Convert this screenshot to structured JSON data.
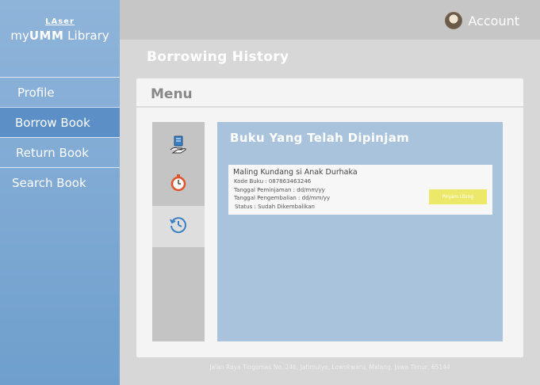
{
  "brand": {
    "logo_top": "LAser",
    "logo_main_prefix": "my",
    "logo_main_bold": "UMM",
    "logo_main_suffix": " Library"
  },
  "sidebar": {
    "items": [
      {
        "label": "Profile"
      },
      {
        "label": "Borrow Book",
        "active": true
      },
      {
        "label": "Return Book"
      },
      {
        "label": "Search Book"
      }
    ]
  },
  "header": {
    "account_label": "Account"
  },
  "page": {
    "title": "Borrowing History"
  },
  "card": {
    "heading": "Menu",
    "icons": [
      "book-hand-icon",
      "stopwatch-icon",
      "history-icon"
    ],
    "content_title": "Buku Yang Telah Dipinjam",
    "book": {
      "title": "Maling Kundang si Anak Durhaka",
      "kode": "Kode Buku : 087863463246",
      "peminjaman": "Tanggal Peminjaman : dd/mm/yy",
      "pengembalian": "Tanggal Pengembalian : dd/mm/yy",
      "status": "Status :  Sudah Dikembalikan",
      "button_label": "Pinjam Ulang"
    }
  },
  "footer": {
    "address": "Jalan Raya Tlogomas No. 246, Jatimulyo, Lowokwaru, Malang, Jawa Timur, 65144"
  },
  "colors": {
    "sidebar": "#7aa7d3",
    "active_nav": "#5b8fc6",
    "content_bg": "#a9c3dc",
    "button": "#ece86a"
  }
}
